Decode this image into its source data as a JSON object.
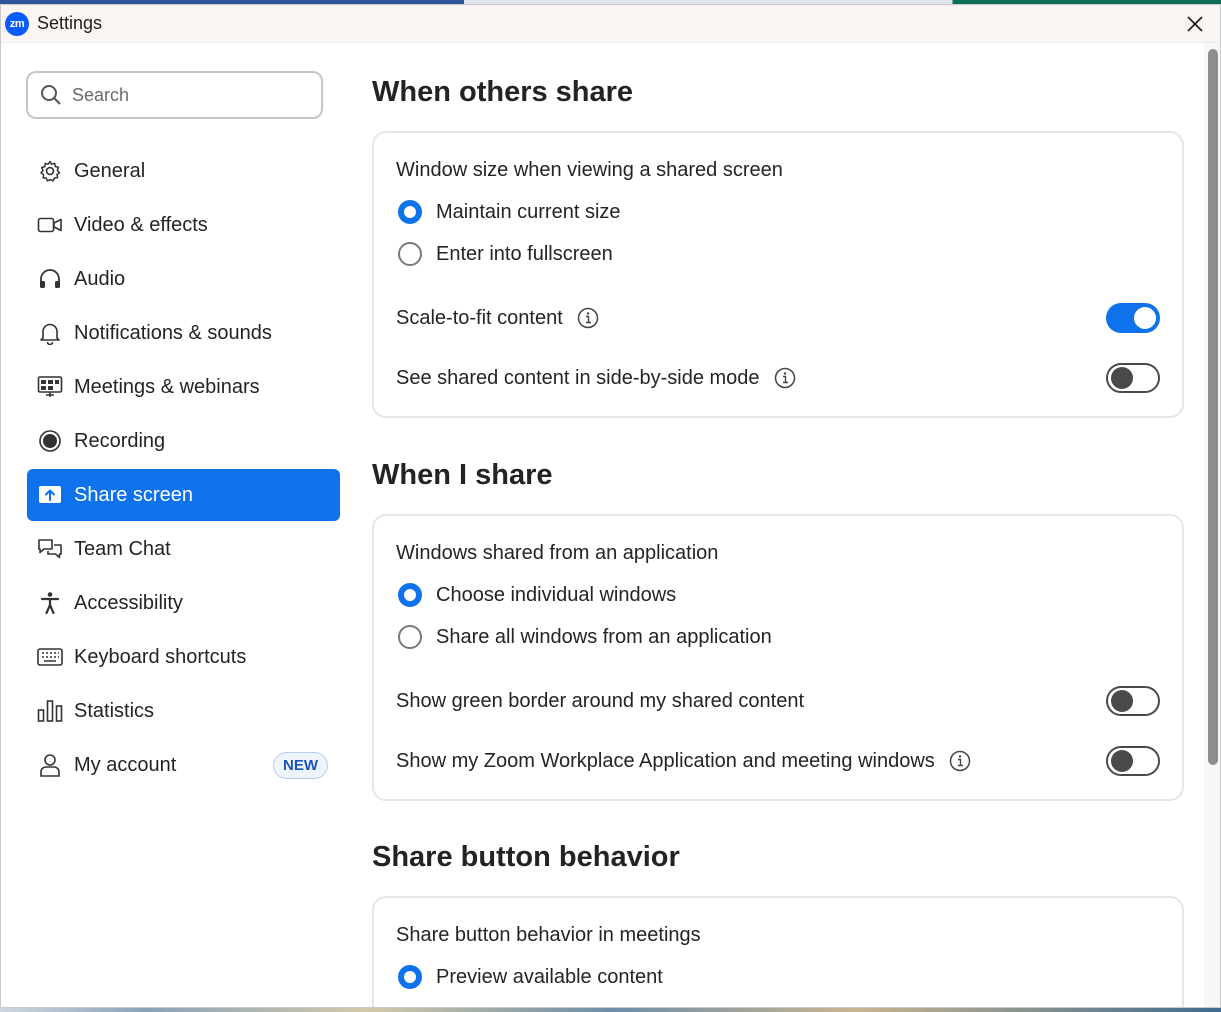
{
  "window": {
    "title": "Settings",
    "logo_text": "zm"
  },
  "search": {
    "placeholder": "Search"
  },
  "sidebar": {
    "items": [
      {
        "label": "General",
        "icon": "gear-icon"
      },
      {
        "label": "Video & effects",
        "icon": "video-camera-icon"
      },
      {
        "label": "Audio",
        "icon": "headphones-icon"
      },
      {
        "label": "Notifications & sounds",
        "icon": "bell-icon"
      },
      {
        "label": "Meetings & webinars",
        "icon": "meetings-icon"
      },
      {
        "label": "Recording",
        "icon": "record-icon"
      },
      {
        "label": "Share screen",
        "icon": "share-screen-icon",
        "active": true
      },
      {
        "label": "Team Chat",
        "icon": "chat-bubbles-icon"
      },
      {
        "label": "Accessibility",
        "icon": "accessibility-icon"
      },
      {
        "label": "Keyboard shortcuts",
        "icon": "keyboard-icon"
      },
      {
        "label": "Statistics",
        "icon": "bar-chart-icon"
      },
      {
        "label": "My account",
        "icon": "person-icon",
        "badge": "NEW"
      }
    ]
  },
  "sections": {
    "others_share": {
      "heading": "When others share",
      "window_size_label": "Window size when viewing a shared screen",
      "radio_maintain": "Maintain current size",
      "radio_fullscreen": "Enter into fullscreen",
      "scale_to_fit": "Scale-to-fit content",
      "side_by_side": "See shared content in side-by-side mode"
    },
    "i_share": {
      "heading": "When I share",
      "windows_label": "Windows shared from an application",
      "radio_individual": "Choose individual windows",
      "radio_all": "Share all windows from an application",
      "green_border": "Show green border around my shared content",
      "show_zoom_windows": "Show my Zoom Workplace Application and meeting windows"
    },
    "share_button": {
      "heading": "Share button behavior",
      "behavior_label": "Share button behavior in meetings",
      "radio_preview": "Preview available content"
    }
  },
  "state": {
    "window_size": "maintain",
    "windows_shared": "individual",
    "share_button": "preview",
    "scale_to_fit": true,
    "side_by_side": false,
    "green_border": false,
    "show_zoom_windows": false
  },
  "colors": {
    "accent": "#0e72ed",
    "active_nav_bg": "#0e72ed",
    "toggle_off": "#4a4a4a"
  }
}
